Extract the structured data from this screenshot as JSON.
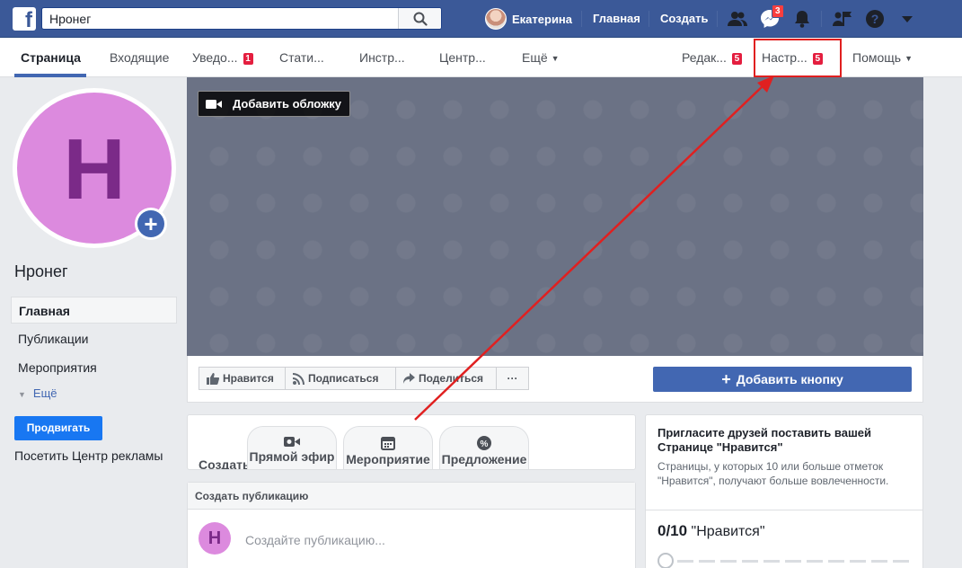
{
  "topbar": {
    "search_value": "Нронег",
    "user_name": "Екатерина",
    "home_label": "Главная",
    "create_label": "Создать",
    "messages_badge": "3"
  },
  "pagenav": {
    "items": [
      {
        "label": "Страница",
        "badge": ""
      },
      {
        "label": "Входящие",
        "badge": ""
      },
      {
        "label": "Уведо...",
        "badge": "1"
      },
      {
        "label": "Стати...",
        "badge": ""
      },
      {
        "label": "Инстр...",
        "badge": ""
      },
      {
        "label": "Центр...",
        "badge": ""
      },
      {
        "label": "Ещё",
        "badge": ""
      },
      {
        "label": "Редак...",
        "badge": "5"
      },
      {
        "label": "Настр...",
        "badge": "5"
      },
      {
        "label": "Помощь",
        "badge": ""
      }
    ]
  },
  "profile": {
    "letter": "Н",
    "page_name": "Нронег"
  },
  "sidebar": {
    "items": [
      {
        "label": "Главная"
      },
      {
        "label": "Публикации"
      },
      {
        "label": "Мероприятия"
      }
    ],
    "more_label": "Ещё",
    "promote_label": "Продвигать",
    "ads_center_label": "Посетить Центр рекламы"
  },
  "cover": {
    "add_cover_label": "Добавить обложку"
  },
  "actions": {
    "like": "Нравится",
    "follow": "Подписаться",
    "share": "Поделиться",
    "more": "···",
    "add_button": "Добавить кнопку"
  },
  "create": {
    "label": "Создать",
    "live": "Прямой эфир",
    "event": "Мероприятие",
    "offer": "Предложение"
  },
  "post": {
    "header": "Создать публикацию",
    "avatar_letter": "Н",
    "placeholder": "Создайте публикацию..."
  },
  "invite": {
    "title": "Пригласите друзей поставить вашей Странице \"Нравится\"",
    "description": "Страницы, у которых 10 или больше отметок \"Нравится\", получают больше вовлеченности.",
    "count": "0/10",
    "count_label": "\"Нравится\"",
    "progress_value": 0
  },
  "colors": {
    "brand": "#3b5998",
    "accent": "#4267b2",
    "annotation": "#e02020"
  }
}
